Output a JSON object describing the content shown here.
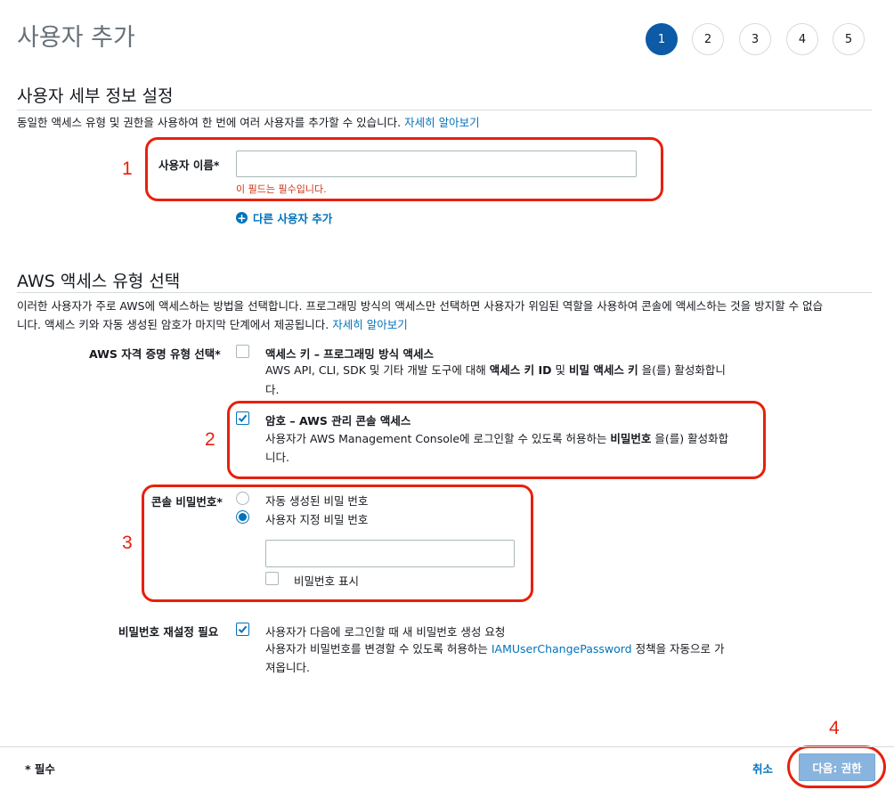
{
  "page_title": "사용자 추가",
  "steps": [
    "1",
    "2",
    "3",
    "4",
    "5"
  ],
  "active_step": "1",
  "details": {
    "title": "사용자 세부 정보 설정",
    "description": "동일한 액세스 유형 및 권한을 사용하여 한 번에 여러 사용자를 추가할 수 있습니다.",
    "learn_more": "자세히 알아보기",
    "username_label": "사용자 이름*",
    "username_value": "",
    "username_error": "이 필드는 필수입니다.",
    "add_user": "다른 사용자 추가"
  },
  "access": {
    "title": "AWS 액세스 유형 선택",
    "description_line1": "이러한 사용자가 주로 AWS에 액세스하는 방법을 선택합니다. 프로그래밍 방식의 액세스만 선택하면 사용자가 위임된 역할을 사용하여 콘솔에 액세스하는 것을 방지할 수 없습",
    "description_line2": "니다. 액세스 키와 자동 생성된 암호가 마지막 단계에서 제공됩니다.",
    "learn_more": "자세히 알아보기",
    "credential_label": "AWS 자격 증명 유형 선택*",
    "programmatic": {
      "title": "액세스 키 – 프로그래밍 방식 액세스",
      "desc_prefix": "AWS API, CLI, SDK 및 기타 개발 도구에 대해 ",
      "desc_bold1": "액세스 키 ID",
      "desc_mid": " 및 ",
      "desc_bold2": "비밀 액세스 키",
      "desc_suffix": " 을(를) 활성화합니",
      "desc_line2": "다.",
      "checked": false
    },
    "console": {
      "title": "암호 – AWS 관리 콘솔 액세스",
      "desc_prefix": "사용자가 AWS Management Console에 로그인할 수 있도록 허용하는 ",
      "desc_bold": "비밀번호",
      "desc_suffix": " 을(를) 활성화합",
      "desc_line2": "니다.",
      "checked": true
    },
    "console_password_label": "콘솔 비밀번호*",
    "password_auto": "자동 생성된 비밀 번호",
    "password_custom": "사용자 지정 비밀 번호",
    "password_value": "",
    "show_password": "비밀번호 표시",
    "reset_label": "비밀번호 재설정 필요",
    "reset_title": "사용자가 다음에 로그인할 때 새 비밀번호 생성 요청",
    "reset_desc_prefix": "사용자가 비밀번호를 변경할 수 있도록 허용하는 ",
    "reset_policy": "IAMUserChangePassword",
    "reset_desc_suffix": " 정책을 자동으로 가",
    "reset_desc_line2": "져옵니다."
  },
  "annotations": [
    "1",
    "2",
    "3",
    "4"
  ],
  "footer": {
    "required_note": "* 필수",
    "cancel": "취소",
    "next": "다음: 권한"
  },
  "colors": {
    "primary": "#0d5aa7",
    "link": "#0073bb",
    "error": "#d13212",
    "annotation": "#e8200c",
    "next_disabled": "#89b4dd"
  }
}
